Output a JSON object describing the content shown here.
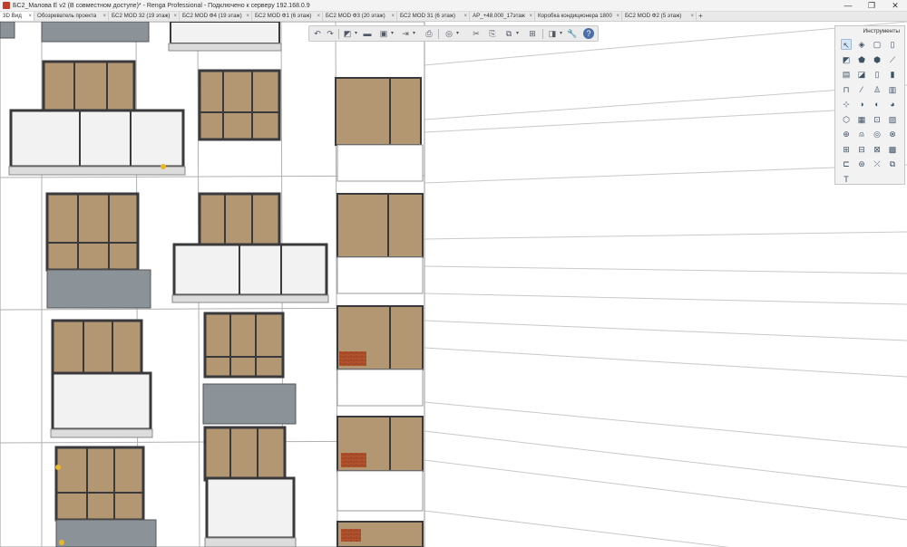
{
  "window": {
    "title": "БС2_Малова Е v2 (В совместном доступе)* - Renga Professional - Подключено к серверу 192.168.0.9",
    "minimize_glyph": "—",
    "maximize_glyph": "❐",
    "close_glyph": "✕"
  },
  "tabs": [
    {
      "label": "3D Вид"
    },
    {
      "label": "Обозреватель проекта"
    },
    {
      "label": "БС2 MOD 32 (19 этаж)"
    },
    {
      "label": "БС2 MOD Ф4 (19 этаж)"
    },
    {
      "label": "БС2 MOD Ф1 (6 этаж)"
    },
    {
      "label": "БС2 MOD Ф3 (20 этаж)"
    },
    {
      "label": "БС2 MOD 31 (6 этаж)"
    },
    {
      "label": "АР_+48.000_17этаж"
    },
    {
      "label": "Коробка кондиционера 1800"
    },
    {
      "label": "БС2 MOD Ф2 (5 этаж)"
    }
  ],
  "tab_close_glyph": "×",
  "tab_add_glyph": "+",
  "toolbar": {
    "undo": "↶",
    "redo": "↷",
    "view3d": "◩",
    "plan": "▬",
    "save": "▣",
    "export": "⇥",
    "print": "⎙",
    "orbit": "◎",
    "cut": "✂",
    "copy": "⎘",
    "paste": "⧉",
    "layers": "⊞",
    "display": "◨",
    "settings": "🔧",
    "help": "?",
    "dropdown": "▾"
  },
  "tools_panel": {
    "title": "Инструменты",
    "tools": [
      {
        "name": "select",
        "glyph": "↖"
      },
      {
        "name": "wall",
        "glyph": "◈"
      },
      {
        "name": "column",
        "glyph": "▢"
      },
      {
        "name": "beam",
        "glyph": "▯"
      },
      {
        "name": "slab",
        "glyph": "◩"
      },
      {
        "name": "roof",
        "glyph": "⬟"
      },
      {
        "name": "door",
        "glyph": "⬢"
      },
      {
        "name": "stair",
        "glyph": "⟋"
      },
      {
        "name": "window",
        "glyph": "▤"
      },
      {
        "name": "opening",
        "glyph": "◪"
      },
      {
        "name": "railing",
        "glyph": "▯"
      },
      {
        "name": "ramp",
        "glyph": "▮"
      },
      {
        "name": "equipment",
        "glyph": "⊓"
      },
      {
        "name": "line",
        "glyph": "⁄"
      },
      {
        "name": "element",
        "glyph": "♙"
      },
      {
        "name": "furniture",
        "glyph": "▥"
      },
      {
        "name": "pipe",
        "glyph": "⊹"
      },
      {
        "name": "duct",
        "glyph": "◑"
      },
      {
        "name": "fitting",
        "glyph": "◐"
      },
      {
        "name": "accessory",
        "glyph": "◕"
      },
      {
        "name": "room",
        "glyph": "⬡"
      },
      {
        "name": "zone",
        "glyph": "▦"
      },
      {
        "name": "rebar",
        "glyph": "⊡"
      },
      {
        "name": "mesh",
        "glyph": "▨"
      },
      {
        "name": "sanitary",
        "glyph": "⊕"
      },
      {
        "name": "lamp",
        "glyph": "⍝"
      },
      {
        "name": "outlet",
        "glyph": "◎"
      },
      {
        "name": "switch",
        "glyph": "⊗"
      },
      {
        "name": "panel",
        "glyph": "⊞"
      },
      {
        "name": "cable",
        "glyph": "⊟"
      },
      {
        "name": "tray",
        "glyph": "⊠"
      },
      {
        "name": "hatch",
        "glyph": "▩"
      },
      {
        "name": "dimension",
        "glyph": "⊏"
      },
      {
        "name": "level",
        "glyph": "⊛"
      },
      {
        "name": "axis",
        "glyph": "⤫"
      },
      {
        "name": "grid",
        "glyph": "⧉"
      },
      {
        "name": "text",
        "glyph": "T"
      }
    ]
  },
  "colors": {
    "glass": "#b39773",
    "frame": "#3a3a3c",
    "wall": "#ffffff",
    "panel_gray": "#8b9298",
    "balcony_panel": "#f2f2f2",
    "brick": "#b5522b"
  }
}
